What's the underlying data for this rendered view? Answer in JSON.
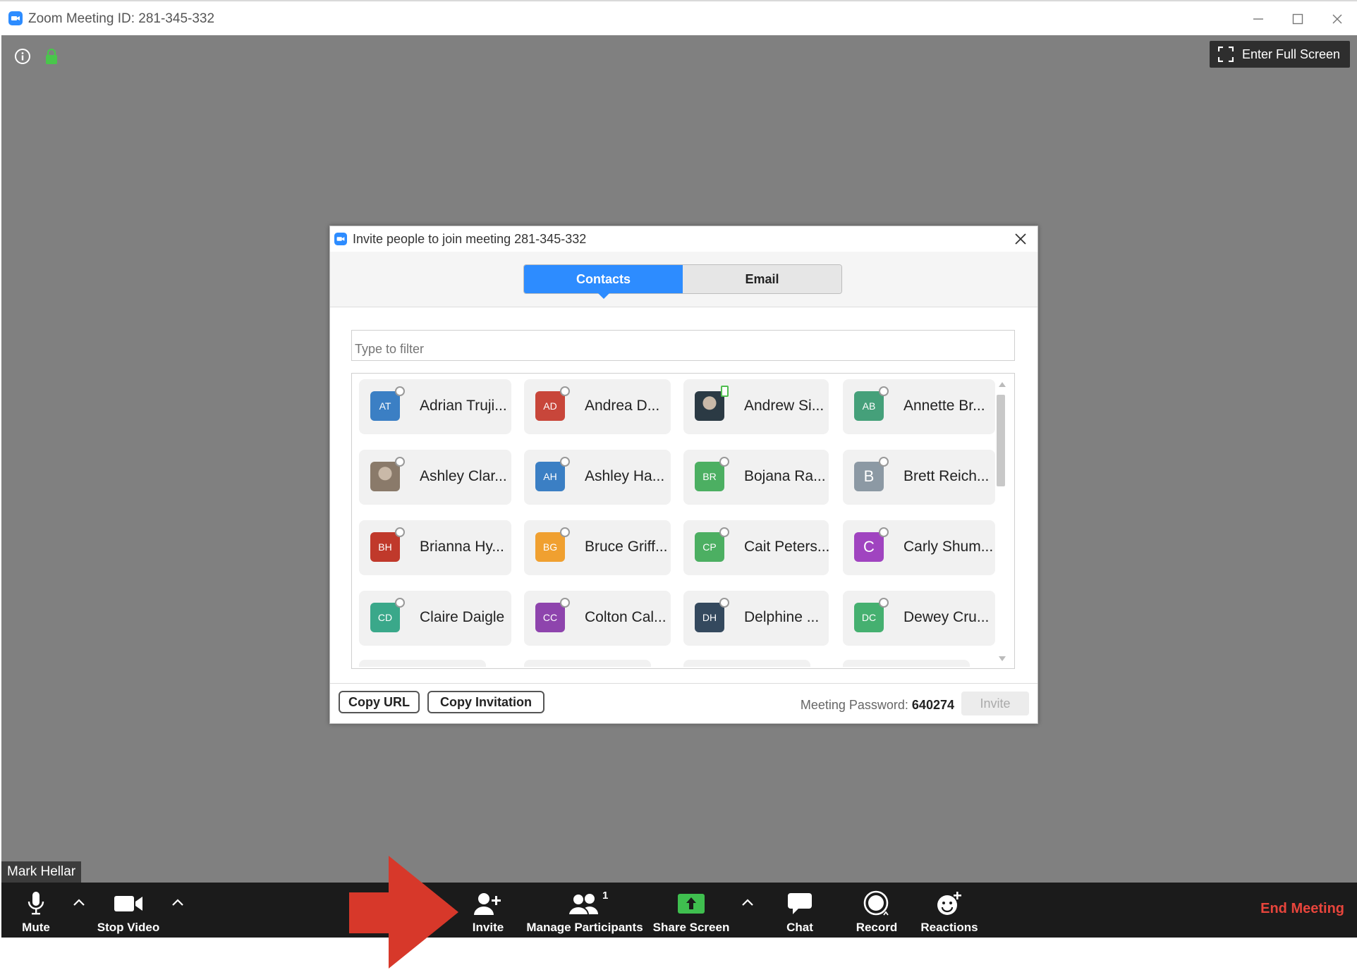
{
  "window": {
    "title": "Zoom Meeting ID: 281-345-332",
    "fullscreen_label": "Enter Full Screen"
  },
  "participant_name": "Mark Hellar",
  "dialog": {
    "title": "Invite people to join meeting 281-345-332",
    "tabs": [
      {
        "label": "Contacts",
        "active": true
      },
      {
        "label": "Email",
        "active": false
      }
    ],
    "filter_placeholder": "Type to filter",
    "contacts": [
      {
        "initials": "AT",
        "name": "Adrian Truji...",
        "color": "#3b7fc4",
        "status": "offline"
      },
      {
        "initials": "AD",
        "name": "Andrea D...",
        "color": "#c8463a",
        "status": "offline"
      },
      {
        "initials": "",
        "name": "Andrew Si...",
        "color": "#2b3a44",
        "status": "online",
        "photo": true
      },
      {
        "initials": "AB",
        "name": "Annette Br...",
        "color": "#45a07a",
        "status": "offline"
      },
      {
        "initials": "",
        "name": "Ashley Clar...",
        "color": "#8a7a6a",
        "status": "offline",
        "photo": true
      },
      {
        "initials": "AH",
        "name": "Ashley Ha...",
        "color": "#3b7fc4",
        "status": "offline"
      },
      {
        "initials": "BR",
        "name": "Bojana Ra...",
        "color": "#4caf62",
        "status": "offline"
      },
      {
        "initials": "B",
        "name": "Brett Reich...",
        "color": "#8c99a4",
        "status": "offline",
        "big": true
      },
      {
        "initials": "BH",
        "name": "Brianna Hy...",
        "color": "#c0392b",
        "status": "offline"
      },
      {
        "initials": "BG",
        "name": "Bruce Griff...",
        "color": "#f0a030",
        "status": "offline"
      },
      {
        "initials": "CP",
        "name": "Cait Peters...",
        "color": "#4caf62",
        "status": "offline"
      },
      {
        "initials": "C",
        "name": "Carly Shum...",
        "color": "#a044c0",
        "status": "offline",
        "big": true
      },
      {
        "initials": "CD",
        "name": "Claire Daigle",
        "color": "#3aa88a",
        "status": "offline"
      },
      {
        "initials": "CC",
        "name": "Colton Cal...",
        "color": "#8e44ad",
        "status": "offline"
      },
      {
        "initials": "DH",
        "name": "Delphine ...",
        "color": "#34495e",
        "status": "offline"
      },
      {
        "initials": "DC",
        "name": "Dewey Cru...",
        "color": "#45b070",
        "status": "offline"
      }
    ],
    "copy_url_label": "Copy URL",
    "copy_invitation_label": "Copy Invitation",
    "password_label": "Meeting Password:",
    "password_value": "640274",
    "invite_label": "Invite"
  },
  "toolbar": {
    "mute_label": "Mute",
    "stop_video_label": "Stop Video",
    "invite_label": "Invite",
    "manage_participants_label": "Manage Participants",
    "participant_count": "1",
    "share_screen_label": "Share Screen",
    "chat_label": "Chat",
    "record_label": "Record",
    "reactions_label": "Reactions",
    "end_meeting_label": "End Meeting"
  },
  "colors": {
    "accent": "#2d8cff",
    "end_meeting": "#e8453c",
    "share_green": "#3fbf4f",
    "annotation_arrow": "#d7382a"
  }
}
